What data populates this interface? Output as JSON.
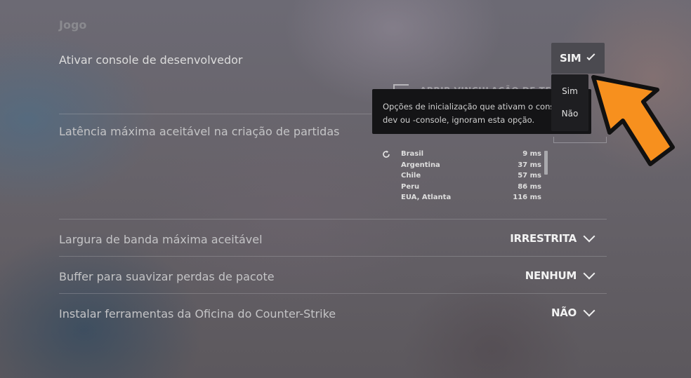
{
  "section": {
    "title": "Jogo"
  },
  "rows": [
    {
      "label": "Ativar console de desenvolvedor",
      "value": "SIM"
    },
    {
      "label": "Latência máxima aceitável na criação de partidas"
    },
    {
      "label": "Largura de banda máxima aceitável",
      "value": "IRRESTRITA"
    },
    {
      "label": "Buffer para suavizar perdas de pacote",
      "value": "NENHUM"
    },
    {
      "label": "Instalar ferramentas da Oficina do Counter-Strike",
      "value": "NÃO"
    }
  ],
  "dropdown": {
    "options": [
      "Sim",
      "Não"
    ]
  },
  "tooltip": {
    "line1": "Opções de inicialização que ativam o conso",
    "line2": "dev ou -console, ignoram esta opção."
  },
  "background_button": {
    "label": "ABRIR VINCULAÇÃO DE TECLA D"
  },
  "regions": [
    {
      "name": "Brasil",
      "ping": "9 ms"
    },
    {
      "name": "Argentina",
      "ping": "37 ms"
    },
    {
      "name": "Chile",
      "ping": "57 ms"
    },
    {
      "name": "Peru",
      "ping": "86 ms"
    },
    {
      "name": "EUA, Atlanta",
      "ping": "116 ms"
    }
  ],
  "icons": {
    "dropdown": "chevron-down-icon",
    "refresh": "refresh-icon",
    "external": "external-link-icon",
    "pointer": "arrow-pointer-icon"
  },
  "colors": {
    "accent_arrow": "#f7901e",
    "arrow_outline": "#111111",
    "tooltip_bg": "#141416",
    "dropdown_bg": "#1e1e21"
  }
}
